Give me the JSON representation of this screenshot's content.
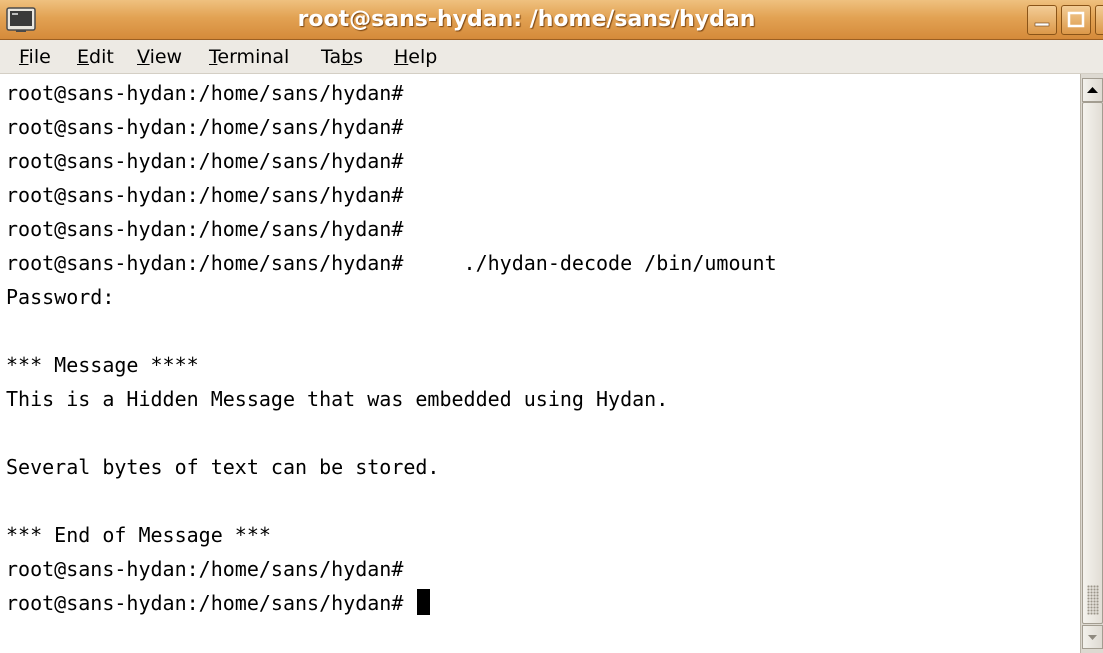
{
  "window": {
    "title": "root@sans-hydan: /home/sans/hydan",
    "icons": {
      "menu": "terminal-icon",
      "minimize": "minimize-icon",
      "maximize": "maximize-icon",
      "close": "close-icon"
    },
    "colors": {
      "titlebar": "#d58a3a",
      "titlebar_light": "#efc17f",
      "menubar": "#edeae4",
      "terminal_bg": "#ffffff",
      "terminal_fg": "#000000"
    }
  },
  "menubar": {
    "items": [
      {
        "pre": "",
        "key": "F",
        "post": "ile"
      },
      {
        "pre": "",
        "key": "E",
        "post": "dit"
      },
      {
        "pre": "",
        "key": "V",
        "post": "iew"
      },
      {
        "pre": "",
        "key": "T",
        "post": "erminal"
      },
      {
        "pre": "Ta",
        "key": "b",
        "post": "s"
      },
      {
        "pre": "",
        "key": "H",
        "post": "elp"
      }
    ]
  },
  "terminal": {
    "lines": [
      "root@sans-hydan:/home/sans/hydan#",
      "root@sans-hydan:/home/sans/hydan#",
      "root@sans-hydan:/home/sans/hydan#",
      "root@sans-hydan:/home/sans/hydan#",
      "root@sans-hydan:/home/sans/hydan#",
      "root@sans-hydan:/home/sans/hydan#     ./hydan-decode /bin/umount",
      "Password:",
      "",
      "*** Message ****",
      "This is a Hidden Message that was embedded using Hydan.",
      "",
      "Several bytes of text can be stored.",
      "",
      "*** End of Message ***",
      "root@sans-hydan:/home/sans/hydan#",
      "root@sans-hydan:/home/sans/hydan# "
    ]
  },
  "scrollbar": {
    "up_icon": "arrow-up-icon",
    "down_icon": "arrow-down-icon"
  }
}
